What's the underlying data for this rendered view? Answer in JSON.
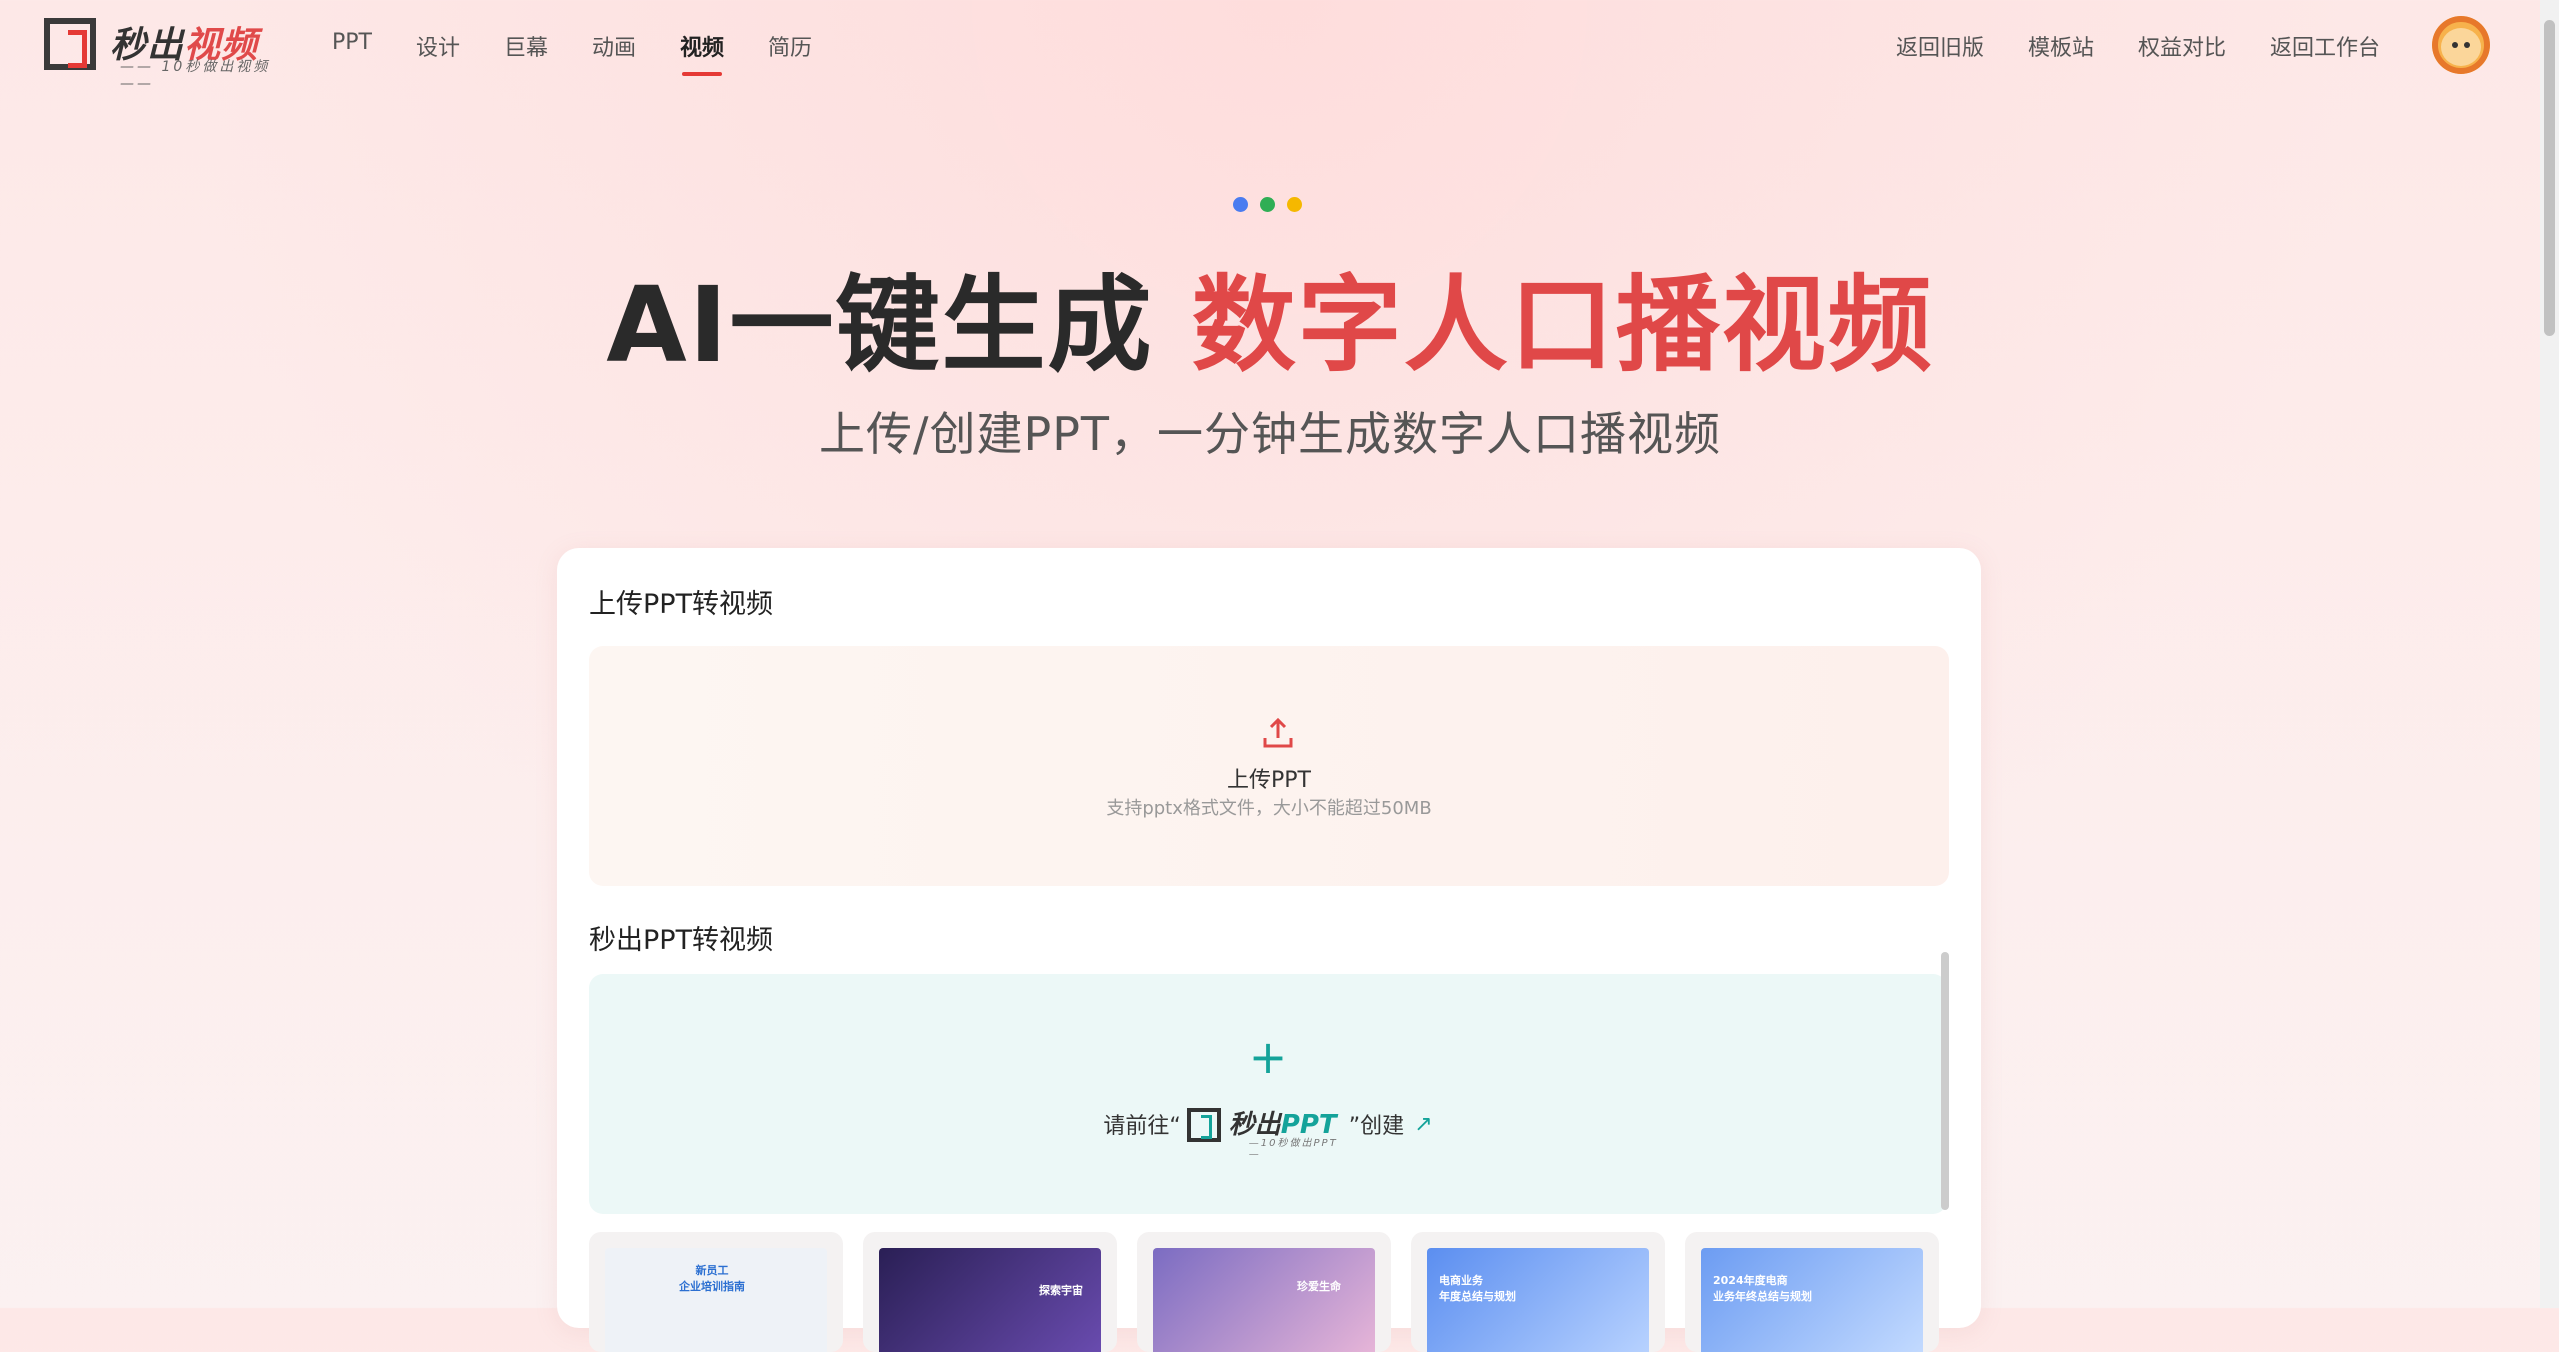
{
  "header": {
    "logo_name_a": "秒出",
    "logo_name_b": "视频",
    "logo_tagline": "10秒做出视频",
    "nav": [
      {
        "label": "PPT"
      },
      {
        "label": "设计"
      },
      {
        "label": "巨幕"
      },
      {
        "label": "动画"
      },
      {
        "label": "视频",
        "active": true
      },
      {
        "label": "简历"
      }
    ],
    "right_nav": [
      {
        "label": "返回旧版"
      },
      {
        "label": "模板站"
      },
      {
        "label": "权益对比"
      },
      {
        "label": "返回工作台"
      }
    ],
    "avatar_icon": "lion-avatar-icon"
  },
  "hero": {
    "dot_colors": [
      "#4a7cf0",
      "#2fae55",
      "#f5b800"
    ],
    "title_plain": "AI一键生成",
    "title_highlight": "数字人口播视频",
    "subtitle": "上传/创建PPT，一分钟生成数字人口播视频"
  },
  "upload_section": {
    "title": "上传PPT转视频",
    "icon": "upload-icon",
    "label": "上传PPT",
    "hint": "支持pptx格式文件，大小不能超过50MB"
  },
  "create_section": {
    "title": "秒出PPT转视频",
    "plus": "+",
    "prefix": "请前往“",
    "logo_a": "秒出",
    "logo_b": "PPT",
    "logo_tag": "10秒做出PPT",
    "suffix": "”创建",
    "arrow": "↗"
  },
  "thumbnails": [
    {
      "caption": "新员工\n企业培训指南",
      "bg": "#eef2f7",
      "color": "#2b6fd1"
    },
    {
      "caption": "探索宇宙",
      "bg": "#3b2a6b",
      "color": "#ffffff"
    },
    {
      "caption": "珍爱生命",
      "bg": "#b59ad6",
      "color": "#ffffff"
    },
    {
      "caption": "电商业务\n年度总结与规划",
      "bg": "#6f9ef0",
      "color": "#ffffff"
    },
    {
      "caption": "2024年度电商\n业务年终总结与规划",
      "bg": "#7aa6f2",
      "color": "#ffffff"
    }
  ],
  "colors": {
    "accent_red": "#e53935",
    "accent_teal": "#14a39a"
  }
}
